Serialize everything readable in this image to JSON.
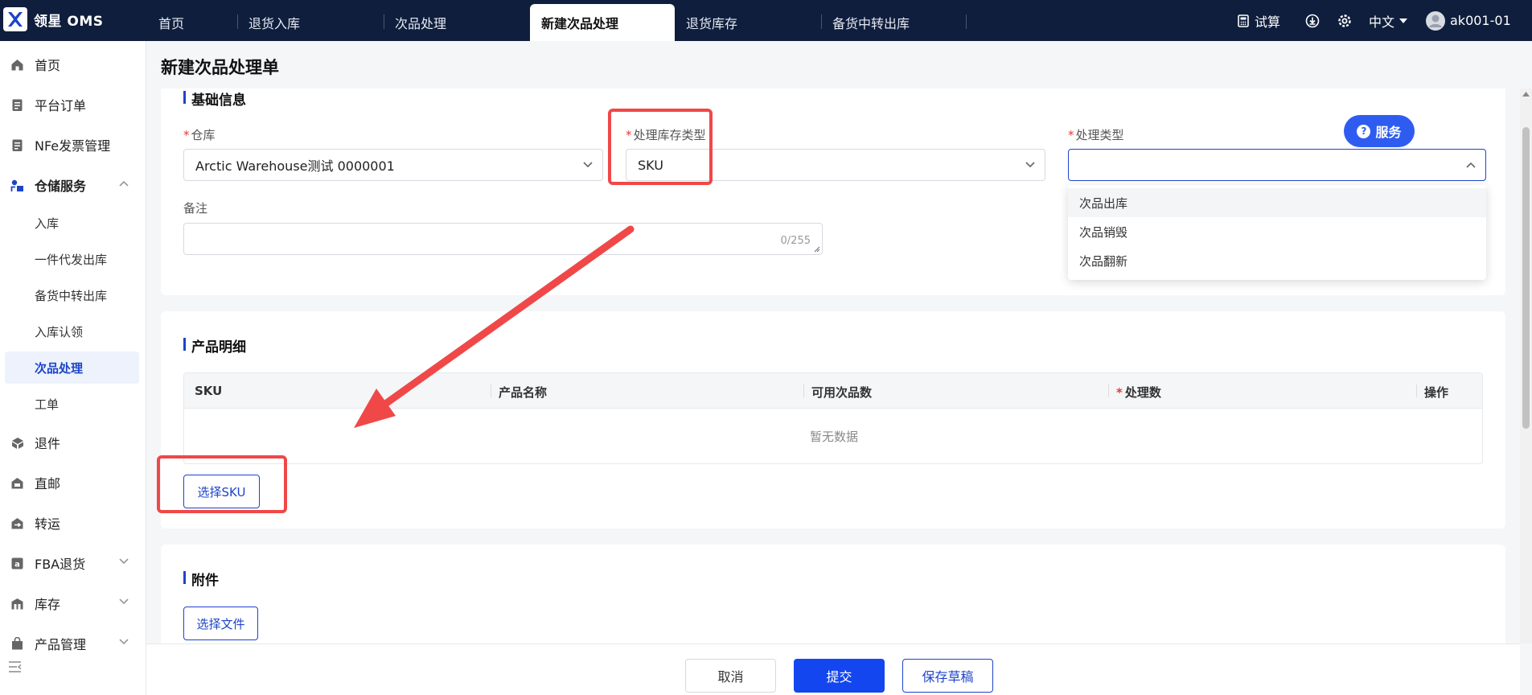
{
  "app": {
    "name": "领星 OMS"
  },
  "tabs": [
    {
      "label": "首页"
    },
    {
      "label": "退货入库"
    },
    {
      "label": "次品处理"
    },
    {
      "label": "新建次品处理"
    },
    {
      "label": "退货库存"
    },
    {
      "label": "备货中转出库"
    }
  ],
  "header_right": {
    "calc_label": "试算",
    "language": "中文",
    "username": "ak001-01"
  },
  "sidebar": {
    "items": [
      {
        "label": "首页",
        "icon": "home-icon"
      },
      {
        "label": "平台订单",
        "icon": "clipboard-icon"
      },
      {
        "label": "NFe发票管理",
        "icon": "clipboard-icon"
      },
      {
        "label": "仓储服务",
        "icon": "warehouse-icon"
      },
      {
        "label": "退件",
        "icon": "return-icon"
      },
      {
        "label": "直邮",
        "icon": "mail-icon"
      },
      {
        "label": "转运",
        "icon": "transfer-icon"
      },
      {
        "label": "FBA退货",
        "icon": "amazon-icon"
      },
      {
        "label": "库存",
        "icon": "inventory-icon"
      },
      {
        "label": "产品管理",
        "icon": "product-icon"
      }
    ],
    "sub_items": [
      {
        "label": "入库"
      },
      {
        "label": "一件代发出库"
      },
      {
        "label": "备货中转出库"
      },
      {
        "label": "入库认领"
      },
      {
        "label": "次品处理"
      },
      {
        "label": "工单"
      }
    ]
  },
  "page": {
    "title": "新建次品处理单"
  },
  "basic": {
    "title": "基础信息",
    "warehouse_label": "仓库",
    "warehouse_value": "Arctic Warehouse测试 0000001",
    "stock_type_label": "处理库存类型",
    "stock_type_value": "SKU",
    "process_type_label": "处理类型",
    "process_type_value": "",
    "remark_label": "备注",
    "remark_count": "0/255",
    "options": [
      "次品出库",
      "次品销毁",
      "次品翻新"
    ]
  },
  "products": {
    "title": "产品明细",
    "columns": [
      "SKU",
      "产品名称",
      "可用次品数",
      "处理数",
      "操作"
    ],
    "empty_text": "暂无数据",
    "select_sku_label": "选择SKU"
  },
  "attachments": {
    "title": "附件",
    "select_file_label": "选择文件"
  },
  "footer": {
    "cancel_label": "取消",
    "submit_label": "提交",
    "draft_label": "保存草稿"
  },
  "service": {
    "label": "服务"
  },
  "colors": {
    "primary": "#1446f0",
    "topbar": "#0f1e3d",
    "highlight": "#f04848"
  }
}
